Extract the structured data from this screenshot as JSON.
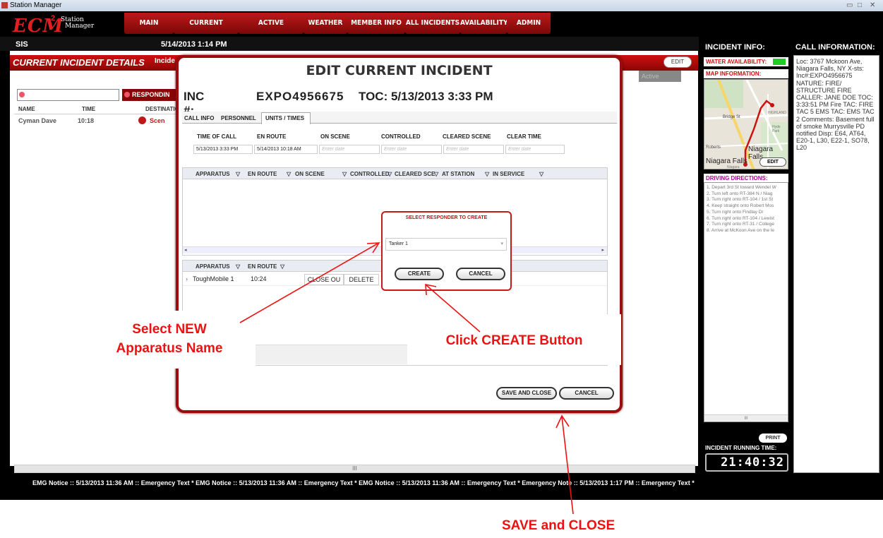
{
  "window": {
    "title": "Station Manager",
    "controls": [
      "▭",
      "□",
      "✕"
    ]
  },
  "header": {
    "logo": "ECM",
    "logo_sup": "2",
    "logo_sub1": "Station",
    "logo_sub2": "Manager",
    "tabs": [
      "MAIN",
      "CURRENT INCIDENT",
      "ACTIVE INCIDENTS",
      "WEATHER",
      "MEMBER INFO",
      "ALL INCIDENTS",
      "AVAILABILITY",
      "ADMIN"
    ]
  },
  "date_bar": {
    "left": "SIS",
    "datetime": "5/14/2013 1:14 PM"
  },
  "details": {
    "title": "CURRENT INCIDENT DETAILS",
    "incident_label": "Incide",
    "edit": "EDIT",
    "status_label": "TUS:",
    "status_value": "Active",
    "responding": "RESPONDIN",
    "list_headers": [
      "NAME",
      "TIME",
      "DESTINATIO"
    ],
    "list_row": {
      "name": "Cyman Dave",
      "time": "10:18",
      "dest": "Scen"
    },
    "scroll_mark": "III"
  },
  "modal": {
    "title": "EDIT CURRENT INCIDENT",
    "inc_label": "INC #:",
    "inc_number": "EXPO4956675",
    "toc": "TOC:  5/13/2013 3:33 PM",
    "tabs": [
      "CALL INFO",
      "PERSONNEL",
      "UNITS / TIMES"
    ],
    "time_labels": [
      "TIME OF CALL",
      "EN ROUTE",
      "ON SCENE",
      "CONTROLLED",
      "CLEARED SCENE",
      "CLEAR TIME"
    ],
    "time_values": [
      "5/13/2013 3:33 PM",
      "5/14/2013 10:18 AM",
      "Enter date",
      "Enter date",
      "Enter date",
      "Enter date"
    ],
    "grid1_headers": [
      "APPARATUS",
      "EN ROUTE",
      "ON SCENE",
      "CONTROLLED",
      "CLEARED SCE",
      "AT STATION",
      "IN SERVICE"
    ],
    "grid2_headers": [
      "APPARATUS",
      "EN ROUTE"
    ],
    "grid2_row": {
      "apparatus": "ToughMobile 1",
      "en_route": "10:24",
      "close": "CLOSE OU",
      "delete": "DELETE"
    },
    "save_close": "SAVE AND CLOSE",
    "cancel": "CANCEL"
  },
  "sub_dialog": {
    "title": "SELECT RESPONDER TO CREATE",
    "selected": "Tanker 1",
    "create": "CREATE",
    "cancel": "CANCEL"
  },
  "incident_info": {
    "title": "INCIDENT INFO:",
    "water": "WATER AVAILABILITY:",
    "water_color": "#22cc22",
    "map": "MAP INFORMATION:",
    "map_labels": [
      "Bridge St",
      "Roberts",
      "Niagara Falls",
      "HIGHLAND",
      "Niagara Falls",
      "Niagara",
      "Hyde Park"
    ],
    "map_edit": "EDIT",
    "directions": "DRIVING DIRECTIONS:",
    "steps": [
      "1. Depart 3rd St toward Wendel W",
      "2. Turn left onto RT-384 N / Niag",
      "3. Turn right onto RT-104 / 1st St",
      "4. Keep straight onto Robert Mos",
      "5. Turn right onto Findlay Dr",
      "6. Turn right onto RT-104 / Lewist",
      "7. Turn right onto RT-31 / College",
      "8. Arrive at McKoon Ave on the le"
    ],
    "dir_scroll": "III",
    "print": "PRINT",
    "running_label": "INCIDENT RUNNING TIME:",
    "running_time": "21:40:32"
  },
  "call_info": {
    "title": "CALL INFORMATION:",
    "text": "Loc: 3767 Mckoon Ave, Niagara Falls, NY X-sts: Inc#:EXPO4956675 NATURE: FIRE/ STRUCTURE FIRE CALLER: JANE DOE TOC: 3:33:51 PM Fire TAC: FIRE TAC 5 EMS TAC: EMS TAC 2 Comments: Basement full of smoke Murrysville PD notified Disp: E64, AT64, E20-1, L30, E22-1, SO78, L20"
  },
  "ticker": "EMG Notice :: 5/13/2013 11:36 AM :: Emergency Text *    EMG Notice :: 5/13/2013 11:36 AM :: Emergency Text *    EMG Notice :: 5/13/2013 11:36 AM :: Emergency Text *    Emergency Note :: 5/13/2013 1:17 PM :: Emergency Text *",
  "annotations": {
    "select_line1": "Select NEW",
    "select_line2": "Apparatus Name",
    "create": "Click CREATE Button",
    "save": "SAVE and CLOSE"
  },
  "colors": {
    "brand_red": "#c01818",
    "annotation_red": "#ee1111"
  }
}
